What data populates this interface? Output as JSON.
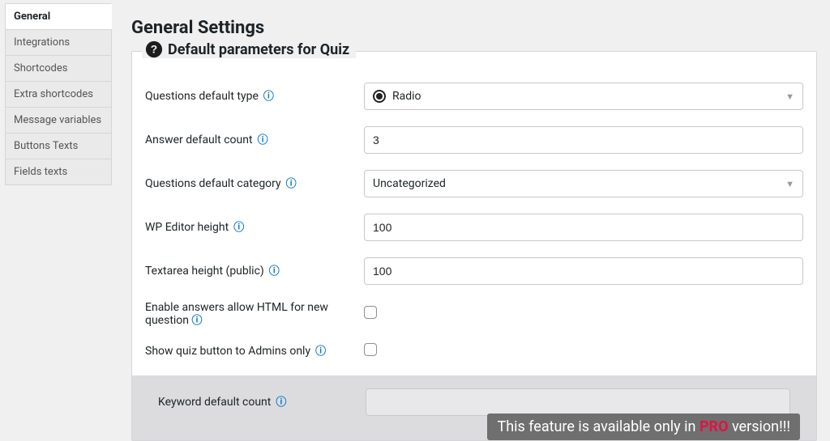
{
  "sidebar": {
    "items": [
      {
        "label": "General",
        "active": true
      },
      {
        "label": "Integrations",
        "active": false
      },
      {
        "label": "Shortcodes",
        "active": false
      },
      {
        "label": "Extra shortcodes",
        "active": false
      },
      {
        "label": "Message variables",
        "active": false
      },
      {
        "label": "Buttons Texts",
        "active": false
      },
      {
        "label": "Fields texts",
        "active": false
      }
    ]
  },
  "header": {
    "title": "General Settings"
  },
  "panel": {
    "title": "Default parameters for Quiz"
  },
  "fields": {
    "question_type": {
      "label": "Questions default type",
      "selected": "Radio"
    },
    "answer_count": {
      "label": "Answer default count",
      "value": "3"
    },
    "question_category": {
      "label": "Questions default category",
      "selected": "Uncategorized"
    },
    "editor_height": {
      "label": "WP Editor height",
      "value": "100"
    },
    "textarea_height": {
      "label": "Textarea height (public)",
      "value": "100"
    },
    "allow_html": {
      "label": "Enable answers allow HTML for new question"
    },
    "admins_only": {
      "label": "Show quiz button to Admins only"
    },
    "keyword_count": {
      "label": "Keyword default count",
      "value": ""
    }
  },
  "pro": {
    "prefix": "This feature is available only in ",
    "pro": "PRO",
    "suffix": " version!!!"
  }
}
